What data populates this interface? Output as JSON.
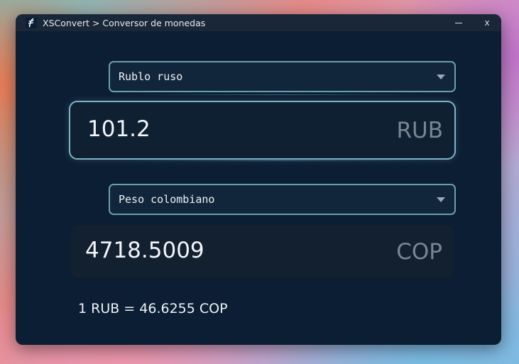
{
  "window": {
    "title": "XSConvert > Conversor de monedas",
    "minimize_icon": "minimize-icon",
    "close_label": "x"
  },
  "source": {
    "currency_name": "Rublo ruso",
    "amount": "101.2",
    "code": "RUB"
  },
  "target": {
    "currency_name": "Peso colombiano",
    "amount": "4718.5009",
    "code": "COP"
  },
  "rate": {
    "text": "1 RUB = 46.6255 COP"
  },
  "colors": {
    "window_background": "#0c1e33",
    "titlebar": "#1a2738",
    "accent_border": "#7fb3c4",
    "muted_code": "#7a8594"
  }
}
